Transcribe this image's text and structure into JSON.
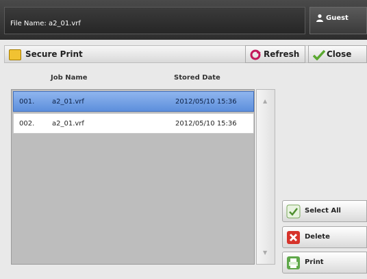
{
  "header": {
    "file_name": "File Name: a2_01.vrf",
    "user_label": "Guest"
  },
  "toolbar": {
    "title": "Secure Print",
    "refresh_label": "Refresh",
    "close_label": "Close"
  },
  "table": {
    "columns": [
      "Job Name",
      "Stored Date"
    ],
    "rows": [
      {
        "num": "001.",
        "name": "a2_01.vrf",
        "date": "2012/05/10 15:36",
        "selected": true
      },
      {
        "num": "002.",
        "name": "a2_01.vrf",
        "date": "2012/05/10 15:36",
        "selected": false
      }
    ]
  },
  "actions": {
    "select_all": "Select All",
    "delete": "Delete",
    "print": "Print"
  },
  "colors": {
    "selection": "#6f9de4",
    "delete_icon": "#d6332b",
    "print_icon": "#5fa84a"
  },
  "icons": {
    "user": "person-icon",
    "secure_print": "lock-icon",
    "refresh": "refresh-icon",
    "close": "checkmark-icon",
    "select_all": "check-icon",
    "delete": "x-icon",
    "print": "printer-icon"
  }
}
